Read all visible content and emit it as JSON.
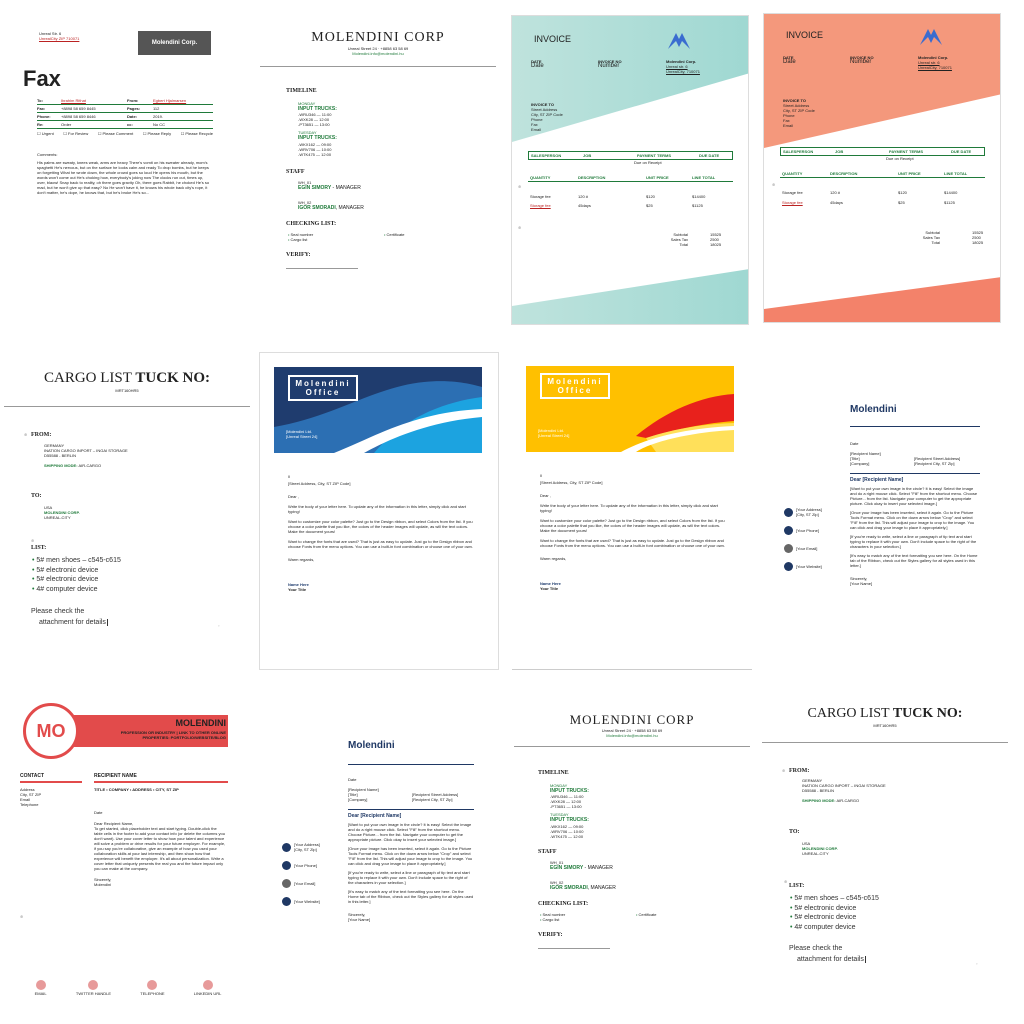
{
  "fax": {
    "address": [
      "Unreal Str. 6",
      "UnrealCity ZIP 710071"
    ],
    "logo": "Molendini Corp.",
    "title": "Fax",
    "rows": [
      [
        "To:",
        "Ibrahim Rithat",
        "From:",
        "Egbert Hjalmarsen"
      ],
      [
        "Fax:",
        "+8898 58 659 8445",
        "Pages:",
        "112"
      ],
      [
        "Phone:",
        "+8898 58 659 8446",
        "Date:",
        "2019."
      ],
      [
        "Re:",
        "Order",
        "cc:",
        "No CC"
      ]
    ],
    "checks": [
      "☐ Urgent",
      "☐ For Review",
      "☐ Please Comment",
      "☐ Please Reply",
      "☐ Please Recycle"
    ],
    "comments_label": "Comments:",
    "comments": "His palms are sweaty, knees weak, arms are heavy There's vomit on his sweater already, mom's spaghetti He's nervous, but on the surface he looks calm and ready To drop bombs, but he keeps on forgetting What he wrote down, the whole crowd goes so loud He opens his mouth, but the words won't come out He's choking how, everybody's joking now The clocks run out, times up, over, blaow! Snap back to reality, oh there goes gravity Oh, there goes Rabbit, he choked He's so mad, but he won't give up that easy? No He won't have it, he knows his whole back city's rope, it don't matter, he's dope, he knows that, but he's broke He's so..."
  },
  "molendini_a": {
    "title": "MOLENDINI CORP",
    "address": "Unreal Street 24 · +8858 63 58 69",
    "email": "Molendini.info@molendini.hu",
    "timeline": "TIMELINE",
    "monday": "MONDAY",
    "trucks": "INPUT TRUCKS:",
    "mon_items": [
      "-WRU346 — 11:00",
      "-WXK28 — 12:00",
      "-PT3651 — 13:00"
    ],
    "tuesday": "TUESDAY",
    "tue_items": [
      "-WKX162 — 09:00",
      "-WRV706 — 10:00",
      "-WTK475 — 12:00"
    ],
    "staff": "STAFF",
    "wh1": "WH_01",
    "wh1_name": "EGIN SIMORY",
    "wh1_role": " - MANAGER",
    "wh2": "WH_02",
    "wh2_name": "IGOR SMORADI",
    "wh2_role": ", MANAGER",
    "checking": "CHECKING LIST:",
    "checks": [
      "Seal number",
      "Cargo list"
    ],
    "check_right": "Certificate",
    "verify": "VERIFY:"
  },
  "invoice_template": {
    "title": "INVOICE",
    "date": "DATE",
    "date_val": "Date",
    "invoice_no": "INVOICE NO",
    "number": "Number",
    "company": "Molendini Corp.",
    "street": "Unreal str. 6",
    "city": "UnrealCity, 710071",
    "invoice_to": "INVOICE TO",
    "to_lines": [
      "Street Address",
      "City, ST ZIP Code",
      "Phone",
      "Fax",
      "Email"
    ],
    "headers": [
      "SALESPERSON",
      "JOB",
      "PAYMENT TERMS",
      "DUE DATE"
    ],
    "due": "Due on Receipt",
    "items_headers": [
      "QUANTITY",
      "DESCRIPTION",
      "UNIT PRICE",
      "LINE TOTAL"
    ],
    "items": [
      [
        "Storage fee",
        "120 #",
        "$120",
        "$14400"
      ],
      [
        "Storage fee",
        "45days",
        "$25",
        "$1125"
      ]
    ],
    "subtotal": "Subtotal",
    "subtotal_v": "15525",
    "tax": "Sales Tax",
    "tax_v": "2500",
    "total": "Total",
    "total_v": "18025"
  },
  "colors": {
    "invoice1": "#a9ddd6",
    "invoice2": "#f49a7e",
    "navy": "#1f3864",
    "mo_red": "#e24b4b",
    "yellow": "#ffc000"
  },
  "cargo": {
    "title_a": "CARGO LIST ",
    "title_b": "TUCK NO:",
    "sub": "MRT160HR5",
    "from": "FROM:",
    "from_lines": [
      "GERMANY",
      "INATION CARGO INPORT – INGAI STORAGE",
      "D55588 - BERLIN"
    ],
    "shipping": "SHIPPING MODE:",
    "shipping_val": " AIR-CARGO",
    "to": "TO:",
    "to_lines_a": "USA",
    "to_company": "MOLENDINI CORP.",
    "to_city": "UNREAL-CITY",
    "list": "LIST:",
    "items": [
      "5# men shoes – c545-c615",
      "5# electronic device",
      "5# electronic device",
      "4# computer device"
    ],
    "note_a": "Please check the",
    "note_b": "attachment for details"
  },
  "office": {
    "brand": "Molendini Office",
    "company": "[Molendini Ltd.",
    "street": "[Unreal Street 24]",
    "addr": "[Street Address, City, ST ZIP Code]",
    "dear": "Dear ,",
    "p1": "Write the body of your letter here. To update any of the information in this letter, simply click and start typing!",
    "p2": "Want to customize your color palette? Just go to the Design ribbon, and select Colors from the list. If you choose a color palette that you like, the colors of the header images will update, as will the text colors. Make the document yours!",
    "p3": "Want to change the fonts that are used? That is just as easy to update. Just go to the Design ribbon and choose Fonts from the menu options. You can use a built-in font combination or choose one of your own.",
    "regards": "Warm regards,",
    "name": "Name Here",
    "ttl": "Your Title",
    "sym": "ll"
  },
  "letter": {
    "title": "Molendini",
    "date": "Date",
    "recipient": [
      "[Recipient Name]",
      "[Title]",
      "[Company]"
    ],
    "rec_right": [
      "[Recipient Street Address]",
      "[Recipient City, ST Zip]"
    ],
    "dear": "Dear [Recipient Name]",
    "p1": "[Want to put your own image in the circle? It is easy! Select the image and do a right mouse click. Select \"Fill\" from the shortcut menu. Choose Picture... from the list. Navigate your computer to get the appropriate picture. Click okay to insert your selected image.]",
    "p2": "[Once your image has been inserted, select it again. Go to the Picture Tools Format menu. Click on the down arrow below \"Crop\" and select \"Fill\" from the list. This will adjust your image to crop to the image. You can click and drag your image to place it appropriately.]",
    "p3": "[If you're ready to write, select a line or paragraph of tip text and start typing to replace it with your own. Don't include space to the right of the characters in your selection.]",
    "p4": "[It's easy to match any of the text formatting you see here. On the Home tab of the Ribbon, check out the Styles gallery for all styles used in this letter.]",
    "sincerely": "Sincerely,",
    "your_name": "[Your Name]",
    "side": [
      "[Your Address]",
      "[City, ST Zip]",
      "[Your Phone]",
      "[Your Email]",
      "[Your Website]"
    ]
  },
  "mo": {
    "initials": "MO",
    "name": "MOLENDINI",
    "tag1": "PROFESSION OR INDUSTRY | LINK TO OTHER ONLINE",
    "tag2": "PROPERTIES: PORTFOLIO/WEBSITE/BLOG",
    "contact": "CONTACT",
    "contact_lines": [
      "Address",
      "City, ST ZIP",
      "Email",
      "Telephone"
    ],
    "recipient": "RECIPIENT NAME",
    "recipient_sub": "TITLE • COMPANY • ADDRESS • CITY, ST ZIP",
    "date": "Date",
    "dear": "Dear Recipient Name,",
    "body": "To get started, click placeholder text and start typing. Double-click the table cells in the footer to add your contact info (or delete the columns you don't want). Use your cover letter to show how your talent and experience will solve a problem or drive results for your future employer. For example, if you say you're collaborative, give an example of how you used your collaboration skills at your last internship, and then show how that experience will benefit the employer. It's all about personalization. Write a cover letter that uniquely presents the real you and the future impact only you can make at the company.",
    "sincerely": "Sincerely,",
    "sign": "Molendini",
    "footer": [
      "EMAIL",
      "TWITTER HANDLE",
      "TELEPHONE",
      "LINKEDIN URL"
    ]
  }
}
